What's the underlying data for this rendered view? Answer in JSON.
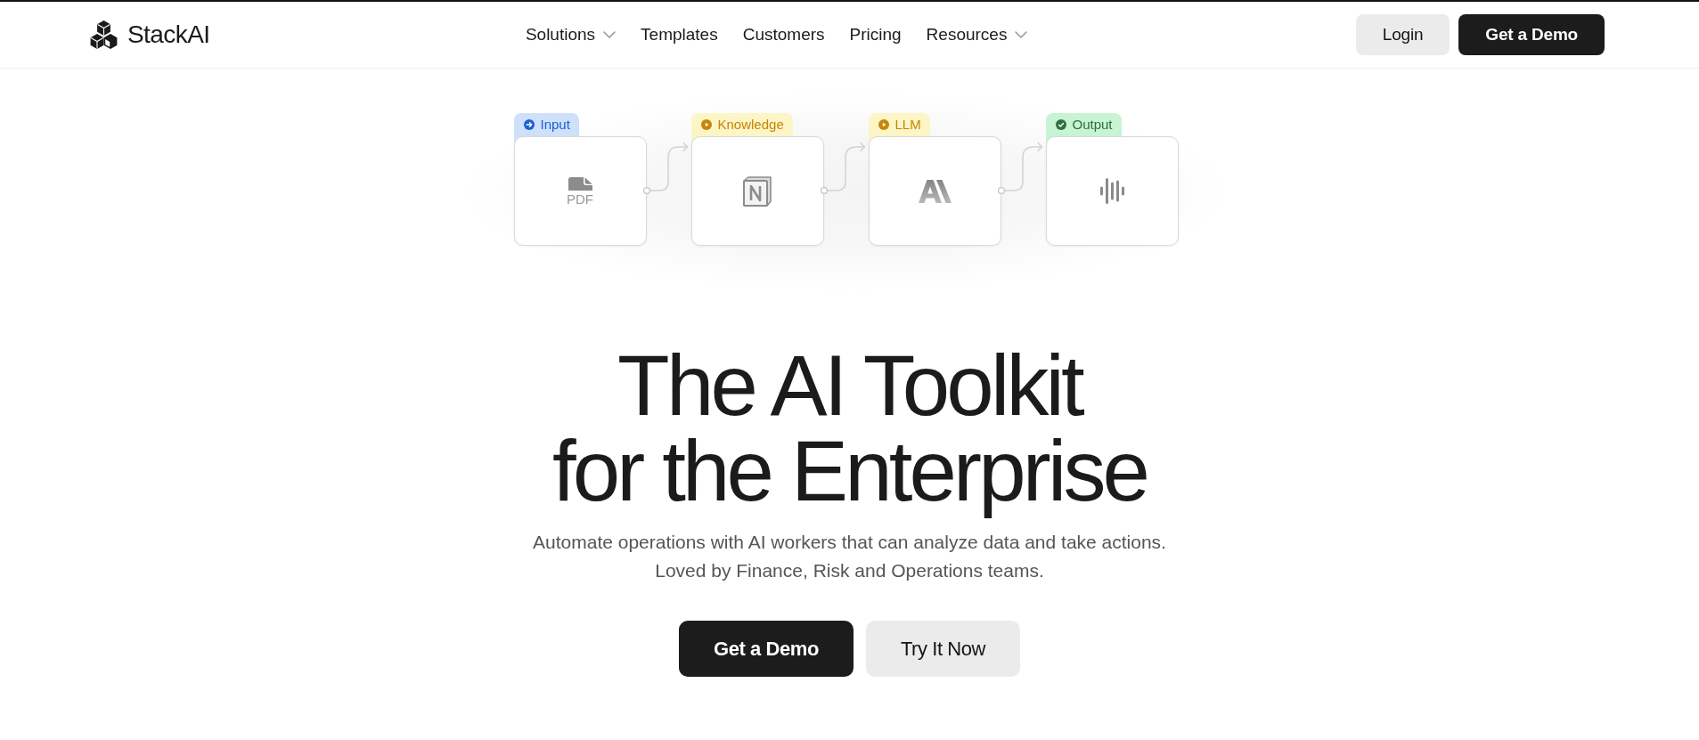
{
  "header": {
    "brand": "StackAI",
    "nav": [
      {
        "label": "Solutions",
        "dropdown": true
      },
      {
        "label": "Templates",
        "dropdown": false
      },
      {
        "label": "Customers",
        "dropdown": false
      },
      {
        "label": "Pricing",
        "dropdown": false
      },
      {
        "label": "Resources",
        "dropdown": true
      }
    ],
    "buttons": [
      {
        "label": "Login",
        "kind": "light"
      },
      {
        "label": "Get a Demo",
        "kind": "dark"
      }
    ]
  },
  "pipeline": {
    "nodes": [
      {
        "label": "Input",
        "kind": "input",
        "color": "#1c5fd6",
        "tab": {
          "color": "#cfe0fa"
        },
        "caption": "PDF"
      },
      {
        "label": "Knowledge",
        "kind": "knowledge",
        "color": "#c48708",
        "tab": {
          "color": "#fcf5c5"
        }
      },
      {
        "label": "LLM",
        "kind": "llm",
        "color": "#c48708",
        "tab": {
          "color": "#fcf5c5"
        }
      },
      {
        "label": "Output",
        "kind": "output",
        "color": "#2f6f3e",
        "tab": {
          "color": "#c9f4d3"
        }
      }
    ]
  },
  "hero": {
    "title_lines": [
      "The AI Toolkit",
      "for the Enterprise"
    ],
    "subtitle_lines": [
      "Automate operations with AI workers that can analyze data and take actions.",
      "Loved by Finance, Risk and Operations teams."
    ],
    "buttons": [
      {
        "label": "Get a Demo",
        "kind": "dark"
      },
      {
        "label": "Try It Now",
        "kind": "light"
      }
    ]
  }
}
